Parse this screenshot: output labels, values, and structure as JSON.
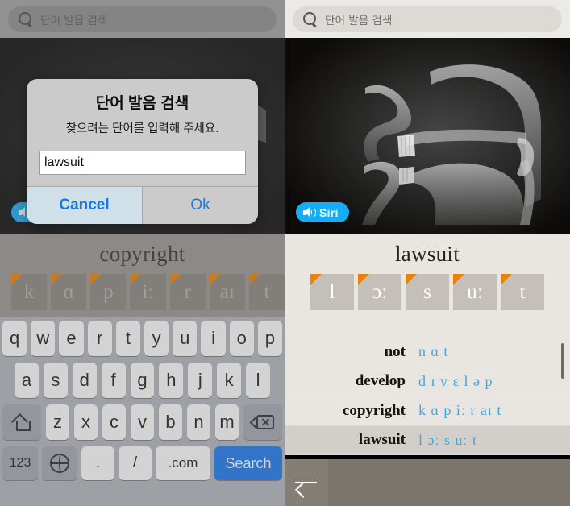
{
  "search": {
    "placeholder": "단어 발음 검색",
    "icon": "search-icon"
  },
  "left_panel": {
    "word": "copyright",
    "phonemes": [
      "k",
      "ɑ",
      "p",
      "iː",
      "r",
      "aɪ",
      "t"
    ],
    "siri_label": "Siri",
    "dialog": {
      "title": "단어 발음 검색",
      "message": "찾으려는 단어를 입력해 주세요.",
      "input_value": "lawsuit",
      "cancel_label": "Cancel",
      "ok_label": "Ok"
    },
    "keyboard": {
      "row1": [
        "q",
        "w",
        "e",
        "r",
        "t",
        "y",
        "u",
        "i",
        "o",
        "p"
      ],
      "row2": [
        "a",
        "s",
        "d",
        "f",
        "g",
        "h",
        "j",
        "k",
        "l"
      ],
      "row3": [
        "z",
        "x",
        "c",
        "v",
        "b",
        "n",
        "m"
      ],
      "shift_icon": "shift-arrow-icon",
      "backspace_icon": "backspace-icon",
      "numbers_label": "123",
      "globe_icon": "globe-icon",
      "period_label": ".",
      "slash_label": "/",
      "dotcom_label": ".com",
      "search_label": "Search"
    }
  },
  "right_panel": {
    "word": "lawsuit",
    "phonemes": [
      "l",
      "ɔː",
      "s",
      "uː",
      "t"
    ],
    "siri_label": "Siri",
    "history": [
      {
        "word": "lawsuit",
        "ipa": "l ɔː s uː t",
        "selected": true
      },
      {
        "word": "copyright",
        "ipa": "k ɑ p iː r aɪ t",
        "selected": false
      },
      {
        "word": "develop",
        "ipa": "d ɪ v ɛ l ə p",
        "selected": false
      },
      {
        "word": "not",
        "ipa": "n ɑ t",
        "selected": false
      }
    ],
    "back_icon": "back-arrow-icon"
  },
  "colors": {
    "siri_blue": "#15aef6",
    "ipa_blue": "#47a3dd",
    "accent_orange": "#f08000",
    "search_key_blue": "#1878f0",
    "nav_bar": "#7b756b",
    "panel_bg": "#e9e6e1"
  }
}
